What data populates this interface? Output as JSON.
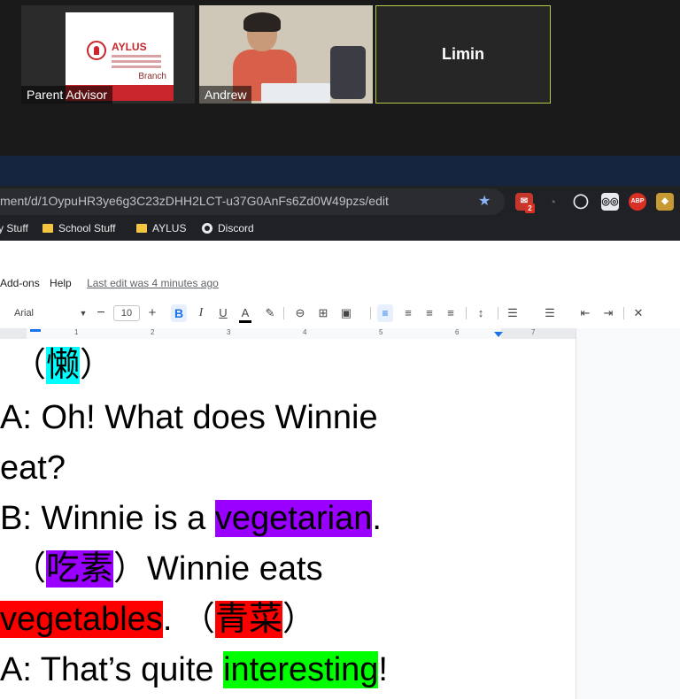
{
  "zoom": {
    "participants": [
      {
        "name": "Parent Advisor"
      },
      {
        "name": "Andrew"
      },
      {
        "name": "Limin"
      }
    ],
    "aylus_card": {
      "logo_text": "AYLUS",
      "branch_text": "Branch"
    }
  },
  "browser": {
    "url": "ment/d/1OypuHR3ye6g3C23zDHH2LCT-u37G0AnFs6Zd0W49pzs/edit",
    "mail_badge": "2",
    "abp_label": "ABP",
    "bookmarks": [
      "y Stuff",
      "School Stuff",
      "AYLUS",
      "Discord"
    ]
  },
  "docs": {
    "menu": [
      "Add-ons",
      "Help"
    ],
    "last_edit": "Last edit was 4 minutes ago",
    "toolbar": {
      "font": "Arial",
      "font_size": "10",
      "bold": "B",
      "italic": "I",
      "underline": "U",
      "text_color": "A"
    },
    "ruler_numbers": [
      "1",
      "2",
      "3",
      "4",
      "5",
      "6",
      "7"
    ]
  },
  "document": {
    "line1": {
      "open": "（",
      "hl": "懒",
      "close": "）"
    },
    "line2": "A: Oh! What does Winnie",
    "line3": "eat?",
    "line4": {
      "pre": "B: Winnie is a ",
      "hl": "vegetarian",
      "post": "."
    },
    "line5": {
      "open": "（",
      "hl": "吃素",
      "post": "）Winnie eats"
    },
    "line6": {
      "hl": "vegetables",
      "mid": ". （",
      "hl2": "青菜",
      "close": "）"
    },
    "line7": {
      "pre": "A: That’s quite ",
      "hl": "interesting",
      "post": "!"
    }
  },
  "colors": {
    "highlight_cyan": "#00ffff",
    "highlight_purple": "#9900ff",
    "highlight_red": "#ff0000",
    "highlight_green": "#00ff00",
    "zoom_active_border": "#b7cc46"
  }
}
